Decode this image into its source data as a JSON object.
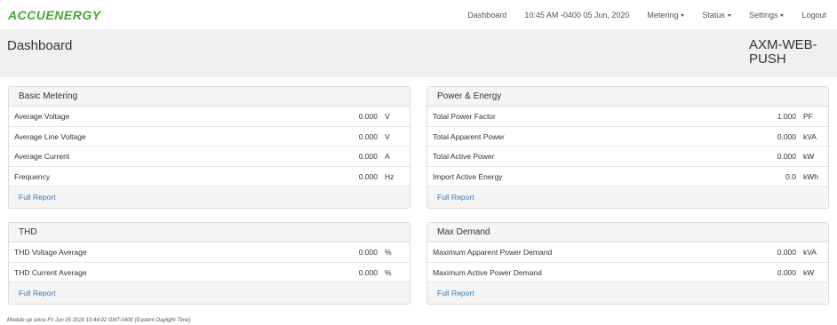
{
  "brand": {
    "logo_text": "ACCUENERGY"
  },
  "nav": {
    "dashboard": "Dashboard",
    "time": "10:45 AM -0400 05 Jun, 2020",
    "metering": "Metering",
    "status": "Status",
    "settings": "Settings",
    "logout": "Logout"
  },
  "header": {
    "title": "Dashboard",
    "device_line1": "AXM-WEB-",
    "device_line2": "PUSH"
  },
  "basic_metering": {
    "title": "Basic Metering",
    "rows": [
      {
        "label": "Average Voltage",
        "value": "0.000",
        "unit": "V"
      },
      {
        "label": "Average Line Voltage",
        "value": "0.000",
        "unit": "V"
      },
      {
        "label": "Average Current",
        "value": "0.000",
        "unit": "A"
      },
      {
        "label": "Frequency",
        "value": "0.000",
        "unit": "Hz"
      }
    ],
    "footer": "Full Report"
  },
  "power_energy": {
    "title": "Power & Energy",
    "rows": [
      {
        "label": "Total Power Factor",
        "value": "1.000",
        "unit": "PF"
      },
      {
        "label": "Total Apparent Power",
        "value": "0.000",
        "unit": "kVA"
      },
      {
        "label": "Total Active Power",
        "value": "0.000",
        "unit": "kW"
      },
      {
        "label": "Import Active Energy",
        "value": "0.0",
        "unit": "kWh"
      }
    ],
    "footer": "Full Report"
  },
  "thd": {
    "title": "THD",
    "rows": [
      {
        "label": "THD Voltage Average",
        "value": "0.000",
        "unit": "%"
      },
      {
        "label": "THD Current Average",
        "value": "0.000",
        "unit": "%"
      }
    ],
    "footer": "Full Report"
  },
  "max_demand": {
    "title": "Max Demand",
    "rows": [
      {
        "label": "Maximum Apparent Power Demand",
        "value": "0.000",
        "unit": "kVA"
      },
      {
        "label": "Maximum Active Power Demand",
        "value": "0.000",
        "unit": "kW"
      }
    ],
    "footer": "Full Report"
  },
  "footer_note": "Module up since Fri Jun 05 2020 10:44:02 GMT-0400 (Eastern Daylight Time)",
  "colors": {
    "brand_green": "#4aa33b",
    "link_blue": "#337ab7",
    "header_bg": "#f0f0f0"
  }
}
